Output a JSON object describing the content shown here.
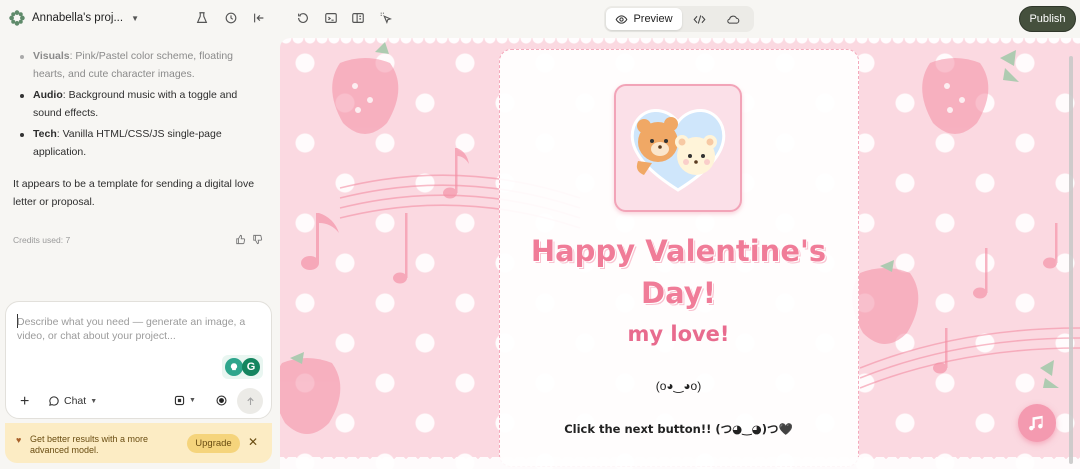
{
  "project": {
    "title": "Annabella's proj..."
  },
  "top": {
    "preview_label": "Preview",
    "publish_label": "Publish"
  },
  "chat": {
    "bullets": [
      {
        "key": "Visuals",
        "text": ": Pink/Pastel color scheme, floating hearts, and cute character images."
      },
      {
        "key": "Audio",
        "text": ": Background music with a toggle and sound effects."
      },
      {
        "key": "Tech",
        "text": ": Vanilla HTML/CSS/JS single-page application."
      }
    ],
    "paragraph": "It appears to be a template for sending a digital love letter or proposal.",
    "credits": "Credits used: 7"
  },
  "composer": {
    "placeholder": "Describe what you need — generate an image, a video, or chat about your project...",
    "mode_label": "Chat"
  },
  "banner": {
    "text": "Get better results with a more advanced model.",
    "upgrade_label": "Upgrade"
  },
  "card": {
    "headline_line1": "Happy Valentine's",
    "headline_line2": "Day!",
    "subtitle": "my love!",
    "kaomoji": "(o◕‿◕o)",
    "next_text": "Click the next button!! (つ◕‿◕)つ🖤"
  },
  "colors": {
    "publish": "#45503d",
    "pink": "#f07c98",
    "banner": "#fcecc4"
  },
  "icons": [
    "settings-icon",
    "history-icon",
    "collapse-icon",
    "refresh-icon",
    "terminal-icon",
    "layout-icon",
    "select-icon",
    "eye-icon",
    "code-icon",
    "cloud-icon",
    "thumbs-up-icon",
    "thumbs-down-icon",
    "chat-icon",
    "plus-icon",
    "mic-icon",
    "send-icon",
    "music-icon",
    "heart-icon",
    "close-icon"
  ]
}
